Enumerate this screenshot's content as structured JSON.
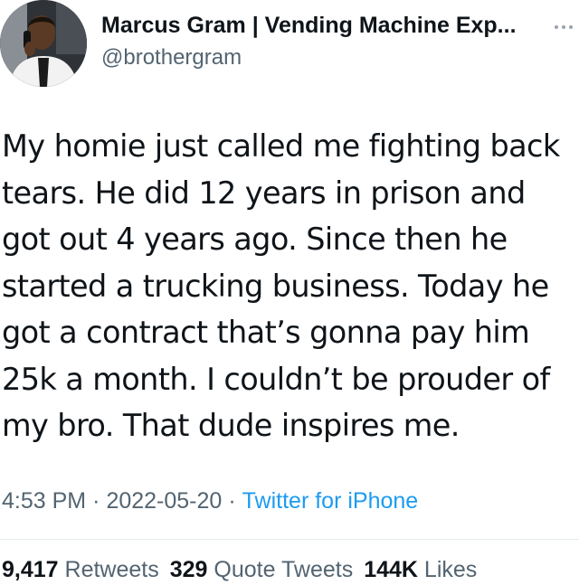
{
  "author": {
    "display_name": "Marcus Gram | Vending Machine Exp...",
    "handle": "@brothergram",
    "avatar_icon": "profile-photo"
  },
  "tweet": {
    "lines": [
      "My homie just called me fighting back",
      "tears. He did 12 years in prison and",
      "got out 4 years ago. Since then he",
      "started a trucking business. Today he",
      "got a contract that’s gonna pay him",
      "25k a month. I couldn’t be prouder of",
      "my bro. That dude inspires me."
    ]
  },
  "meta": {
    "time": "4:53 PM",
    "separator": "·",
    "date": "2022-05-20",
    "source": "Twitter for iPhone"
  },
  "stats": {
    "retweets_count": "9,417",
    "retweets_label": "Retweets",
    "quotes_count": "329",
    "quotes_label": "Quote Tweets",
    "likes_count": "144K",
    "likes_label": "Likes"
  },
  "colors": {
    "text": "#0f1419",
    "secondary": "#536471",
    "link": "#1d9bf0",
    "divider": "#e6ecf0"
  }
}
